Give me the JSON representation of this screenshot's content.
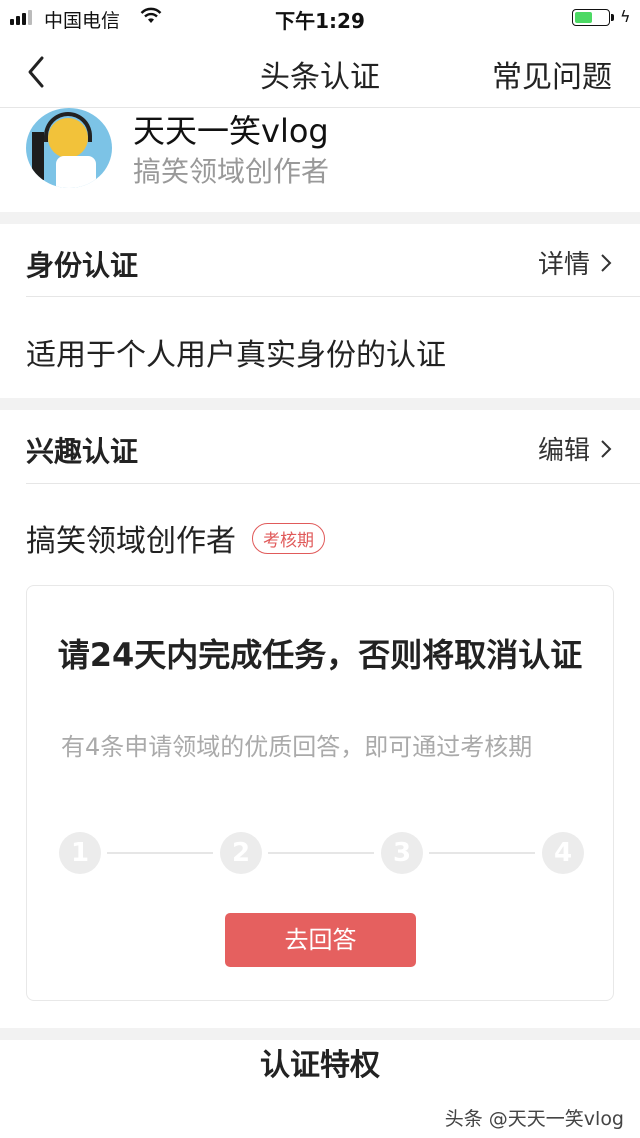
{
  "status_bar": {
    "carrier": "中国电信",
    "time": "下午1:29",
    "battery_level": 0.55,
    "battery_color": "#4cd964"
  },
  "nav": {
    "back_icon": "chevron-left-icon",
    "title": "头条认证",
    "faq": "常见问题"
  },
  "profile": {
    "name": "天天一笑vlog",
    "role": "搞笑领域创作者"
  },
  "identity": {
    "label": "身份认证",
    "link": "详情",
    "desc": "适用于个人用户真实身份的认证"
  },
  "interest": {
    "label": "兴趣认证",
    "link": "编辑",
    "field": "搞笑领域创作者",
    "badge": "考核期"
  },
  "task": {
    "heading": "请24天内完成任务，否则将取消认证",
    "sub": "有4条申请领域的优质回答，即可通过考核期",
    "steps": [
      "1",
      "2",
      "3",
      "4"
    ],
    "button": "去回答"
  },
  "privileges": {
    "title": "认证特权"
  },
  "watermark": "头条 @天天一笑vlog",
  "colors": {
    "accent": "#e5605f",
    "badge": "#e05a5a",
    "muted_text": "#999999"
  }
}
